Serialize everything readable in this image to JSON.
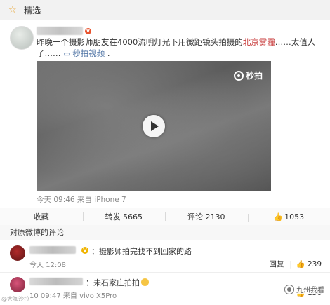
{
  "header": {
    "icon": "star-outline-icon",
    "title": "精选"
  },
  "post": {
    "text_before": "昨晚一个摄影师朋友在4000流明灯光下用微距镜头拍摄的",
    "text_highlight": "北京雾霾",
    "text_after": "……太值人了……",
    "video_link_icon": "video-icon",
    "video_link_label": "秒拍视频",
    "video_brand": "秒拍",
    "meta": "今天 09:46 来自 iPhone 7"
  },
  "actions": {
    "favorite": "收藏",
    "repost": "转发 5665",
    "comment": "评论 2130",
    "like": "1053"
  },
  "comments_header": "对原微博的评论",
  "comments": [
    {
      "text": "：摄影师拍完找不到回家的路",
      "time": "今天 12:08",
      "reply": "回复",
      "likes": "239"
    },
    {
      "text": "：未石家庄拍拍",
      "time": "10 09:47 来自 vivo X5Pro",
      "likes": "136"
    }
  ],
  "watermarks": {
    "left": "@大咖沙拉",
    "right": "九州我看"
  },
  "colors": {
    "highlight_red": "#c93f3f",
    "link_blue": "#5276a6",
    "vip_orange": "#e8542f",
    "star": "#e8a534"
  }
}
